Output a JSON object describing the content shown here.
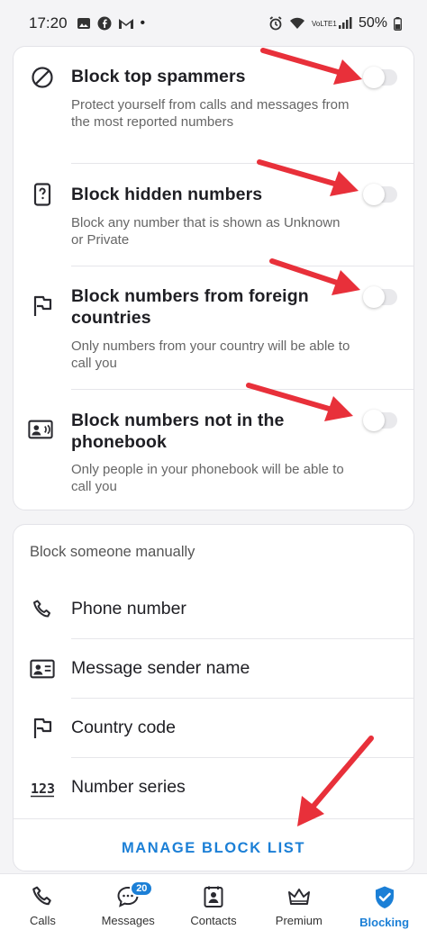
{
  "status_bar": {
    "time": "17:20",
    "battery": "50%",
    "network_label": "VoLTE1"
  },
  "auto_block": {
    "items": [
      {
        "title": "Block top spammers",
        "description": "Protect yourself from calls and messages from the most reported numbers",
        "icon": "block-circle-icon",
        "enabled": false
      },
      {
        "title": "Block hidden numbers",
        "description": "Block any number that is shown as Unknown or Private",
        "icon": "hidden-number-icon",
        "enabled": false
      },
      {
        "title": "Block numbers from foreign countries",
        "description": "Only numbers from your country will be able to call you",
        "icon": "flag-icon",
        "enabled": false
      },
      {
        "title": "Block numbers not in the phonebook",
        "description": "Only people in your phonebook will be able to call you",
        "icon": "contact-card-icon",
        "enabled": false
      }
    ]
  },
  "manual_block": {
    "heading": "Block someone manually",
    "items": [
      {
        "label": "Phone number",
        "icon": "phone-icon"
      },
      {
        "label": "Message sender name",
        "icon": "sender-card-icon"
      },
      {
        "label": "Country code",
        "icon": "flag-icon"
      },
      {
        "label": "Number series",
        "icon": "number-series-icon"
      }
    ],
    "manage_label": "MANAGE BLOCK LIST"
  },
  "bottom_nav": {
    "items": [
      {
        "label": "Calls",
        "icon": "phone-icon"
      },
      {
        "label": "Messages",
        "icon": "message-icon",
        "badge": "20"
      },
      {
        "label": "Contacts",
        "icon": "contacts-icon"
      },
      {
        "label": "Premium",
        "icon": "crown-icon"
      },
      {
        "label": "Blocking",
        "icon": "shield-check-icon",
        "active": true
      }
    ]
  },
  "colors": {
    "accent": "#1b7fd6",
    "annotation_arrow": "#e8303a"
  }
}
